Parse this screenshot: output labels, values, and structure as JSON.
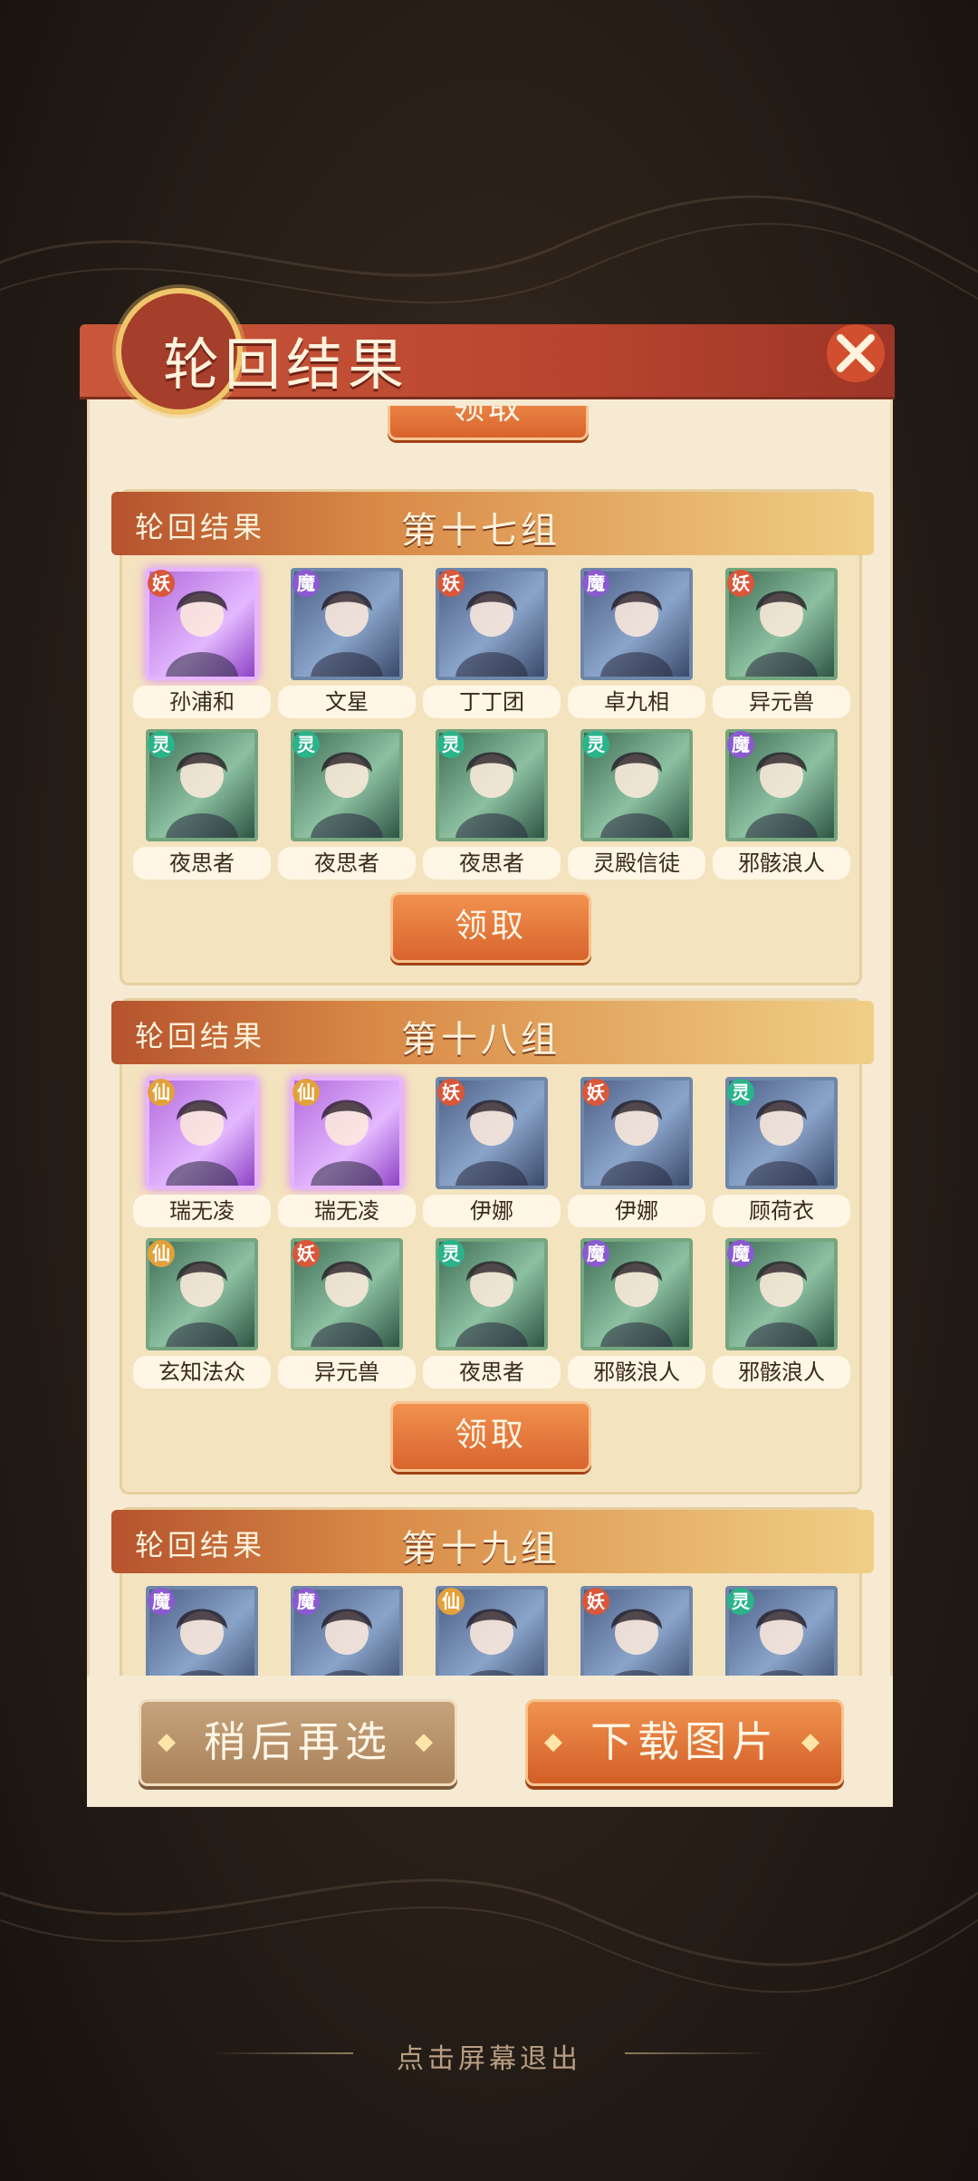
{
  "header": {
    "title": "轮回结果"
  },
  "top_stub_button": "领取",
  "groups": [
    {
      "label": "轮回结果",
      "group": "第十七组",
      "claim": "领取",
      "row1": [
        {
          "name": "孙浦和",
          "badge": "妖",
          "badge_color": "#d9573a",
          "frame": "purple"
        },
        {
          "name": "文星",
          "badge": "魔",
          "badge_color": "#8b5ad1",
          "frame": "blue"
        },
        {
          "name": "丁丁团",
          "badge": "妖",
          "badge_color": "#d9573a",
          "frame": "blue"
        },
        {
          "name": "卓九相",
          "badge": "魔",
          "badge_color": "#8b5ad1",
          "frame": "blue"
        },
        {
          "name": "异元兽",
          "badge": "妖",
          "badge_color": "#d9573a",
          "frame": "green"
        }
      ],
      "row2": [
        {
          "name": "夜思者",
          "badge": "灵",
          "badge_color": "#2bb38a",
          "frame": "green"
        },
        {
          "name": "夜思者",
          "badge": "灵",
          "badge_color": "#2bb38a",
          "frame": "green"
        },
        {
          "name": "夜思者",
          "badge": "灵",
          "badge_color": "#2bb38a",
          "frame": "green"
        },
        {
          "name": "灵殿信徒",
          "badge": "灵",
          "badge_color": "#2bb38a",
          "frame": "green"
        },
        {
          "name": "邪骸浪人",
          "badge": "魔",
          "badge_color": "#8b5ad1",
          "frame": "green"
        }
      ]
    },
    {
      "label": "轮回结果",
      "group": "第十八组",
      "claim": "领取",
      "row1": [
        {
          "name": "瑞无凌",
          "badge": "仙",
          "badge_color": "#e2a13a",
          "frame": "purple"
        },
        {
          "name": "瑞无凌",
          "badge": "仙",
          "badge_color": "#e2a13a",
          "frame": "purple"
        },
        {
          "name": "伊娜",
          "badge": "妖",
          "badge_color": "#d9573a",
          "frame": "blue"
        },
        {
          "name": "伊娜",
          "badge": "妖",
          "badge_color": "#d9573a",
          "frame": "blue"
        },
        {
          "name": "顾荷衣",
          "badge": "灵",
          "badge_color": "#2bb38a",
          "frame": "blue"
        }
      ],
      "row2": [
        {
          "name": "玄知法众",
          "badge": "仙",
          "badge_color": "#e2a13a",
          "frame": "green"
        },
        {
          "name": "异元兽",
          "badge": "妖",
          "badge_color": "#d9573a",
          "frame": "green"
        },
        {
          "name": "夜思者",
          "badge": "灵",
          "badge_color": "#2bb38a",
          "frame": "green"
        },
        {
          "name": "邪骸浪人",
          "badge": "魔",
          "badge_color": "#8b5ad1",
          "frame": "green"
        },
        {
          "name": "邪骸浪人",
          "badge": "魔",
          "badge_color": "#8b5ad1",
          "frame": "green"
        }
      ]
    },
    {
      "label": "轮回结果",
      "group": "第十九组",
      "row1": [
        {
          "badge": "魔",
          "badge_color": "#8b5ad1",
          "frame": "blue"
        },
        {
          "badge": "魔",
          "badge_color": "#8b5ad1",
          "frame": "blue"
        },
        {
          "badge": "仙",
          "badge_color": "#e2a13a",
          "frame": "blue"
        },
        {
          "badge": "妖",
          "badge_color": "#d9573a",
          "frame": "blue"
        },
        {
          "badge": "灵",
          "badge_color": "#2bb38a",
          "frame": "blue"
        }
      ]
    }
  ],
  "buttons": {
    "later": "稍后再选",
    "download": "下载图片"
  },
  "exit_hint": "点击屏幕退出"
}
